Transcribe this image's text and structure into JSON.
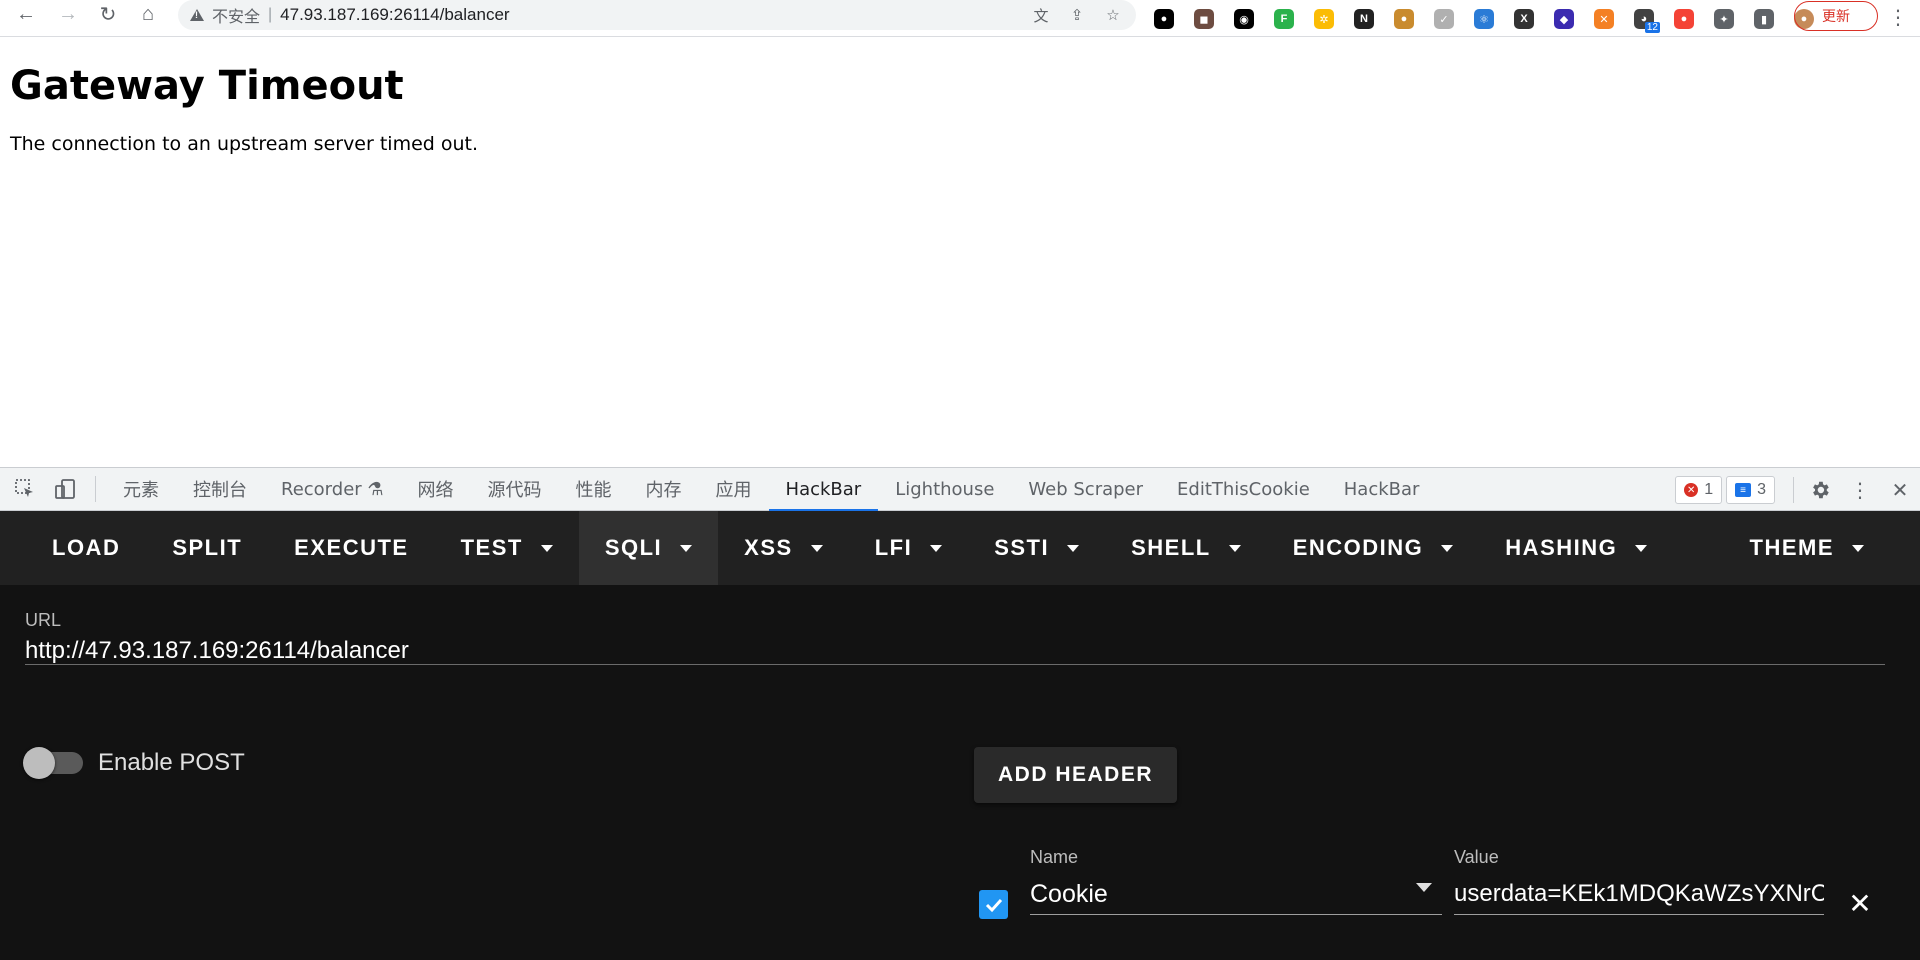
{
  "browser": {
    "security_label": "不安全",
    "address": "47.93.187.169:26114/balancer",
    "update_label": "更新",
    "extensions": [
      {
        "name": "circle-ext-icon",
        "color": "#000000",
        "glyph": "●"
      },
      {
        "name": "avatar-ext-icon",
        "color": "#6d4c41",
        "glyph": "◼"
      },
      {
        "name": "tampermonkey-icon",
        "color": "#000000",
        "glyph": "◉"
      },
      {
        "name": "feedly-icon",
        "color": "#2bb24c",
        "glyph": "F"
      },
      {
        "name": "pinwheel-icon",
        "color": "#fbbc05",
        "glyph": "✲"
      },
      {
        "name": "notion-icon",
        "color": "#222222",
        "glyph": "N"
      },
      {
        "name": "cookie-icon",
        "color": "#c98b2e",
        "glyph": "●"
      },
      {
        "name": "check-icon",
        "color": "#b0b0b0",
        "glyph": "✓"
      },
      {
        "name": "atom-icon",
        "color": "#2a7bd6",
        "glyph": "⚛"
      },
      {
        "name": "x-ext-icon",
        "color": "#333333",
        "glyph": "X"
      },
      {
        "name": "wappalyzer-icon",
        "color": "#3b2bb0",
        "glyph": "◆"
      },
      {
        "name": "orange-ext-icon",
        "color": "#f48024",
        "glyph": "✕"
      },
      {
        "name": "spy-ext-icon",
        "color": "#424242",
        "glyph": "◕"
      },
      {
        "name": "red-ext-icon",
        "color": "#f44336",
        "glyph": "●"
      },
      {
        "name": "puzzle-icon",
        "color": "#5f6368",
        "glyph": "✦"
      },
      {
        "name": "sidebar-icon",
        "color": "#5f6368",
        "glyph": "▮"
      },
      {
        "name": "profile-avatar",
        "color": "#c68b59",
        "glyph": "●"
      }
    ],
    "extension_badge": "12"
  },
  "page": {
    "title": "Gateway Timeout",
    "message": "The connection to an upstream server timed out."
  },
  "devtools": {
    "tabs": [
      {
        "label": "元素",
        "active": false
      },
      {
        "label": "控制台",
        "active": false
      },
      {
        "label": "Recorder ⚗",
        "active": false
      },
      {
        "label": "网络",
        "active": false
      },
      {
        "label": "源代码",
        "active": false
      },
      {
        "label": "性能",
        "active": false
      },
      {
        "label": "内存",
        "active": false
      },
      {
        "label": "应用",
        "active": false
      },
      {
        "label": "HackBar",
        "active": true
      },
      {
        "label": "Lighthouse",
        "active": false
      },
      {
        "label": "Web Scraper",
        "active": false
      },
      {
        "label": "EditThisCookie",
        "active": false
      },
      {
        "label": "HackBar",
        "active": false
      }
    ],
    "error_count": "1",
    "message_count": "3"
  },
  "hackbar": {
    "toolbar": [
      {
        "label": "LOAD",
        "dropdown": false,
        "active": false
      },
      {
        "label": "SPLIT",
        "dropdown": false,
        "active": false
      },
      {
        "label": "EXECUTE",
        "dropdown": false,
        "active": false
      },
      {
        "label": "TEST",
        "dropdown": true,
        "active": false
      },
      {
        "label": "SQLI",
        "dropdown": true,
        "active": true
      },
      {
        "label": "XSS",
        "dropdown": true,
        "active": false
      },
      {
        "label": "LFI",
        "dropdown": true,
        "active": false
      },
      {
        "label": "SSTI",
        "dropdown": true,
        "active": false
      },
      {
        "label": "SHELL",
        "dropdown": true,
        "active": false
      },
      {
        "label": "ENCODING",
        "dropdown": true,
        "active": false
      },
      {
        "label": "HASHING",
        "dropdown": true,
        "active": false
      },
      {
        "label": "THEME",
        "dropdown": true,
        "active": false
      }
    ],
    "url_label": "URL",
    "url_value": "http://47.93.187.169:26114/balancer",
    "enable_post_label": "Enable POST",
    "enable_post_on": false,
    "add_header_label": "ADD HEADER",
    "header": {
      "enabled": true,
      "name_label": "Name",
      "name_value": "Cookie",
      "value_label": "Value",
      "value_value": "userdata=KEk1MDQKaWZsYXNrC"
    }
  }
}
